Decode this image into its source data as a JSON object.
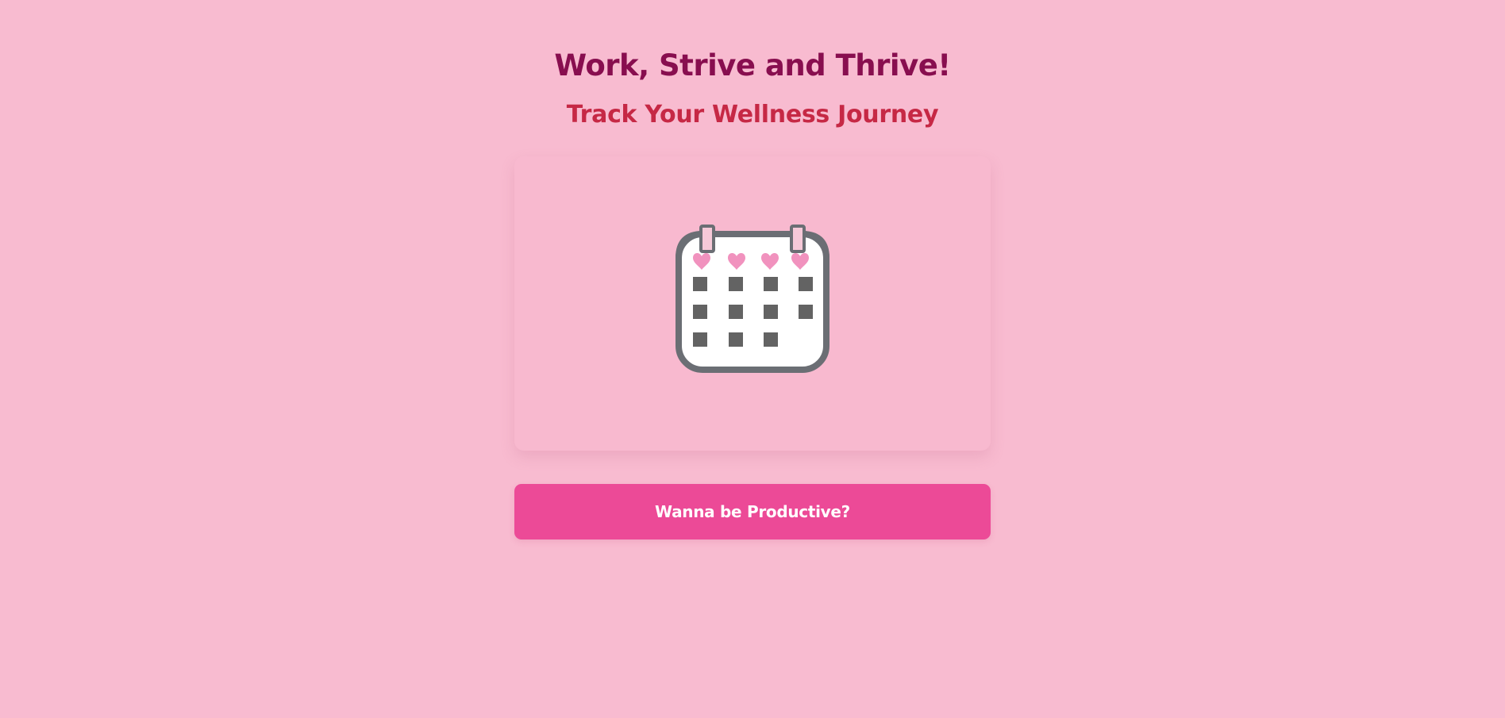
{
  "header": {
    "title": "Work, Strive and Thrive!",
    "subtitle": "Track Your Wellness Journey"
  },
  "card": {
    "icon": "calendar-hearts-icon"
  },
  "cta": {
    "label": "Wanna be Productive?"
  },
  "colors": {
    "background": "#f8bbd0",
    "title": "#880e4f",
    "subtitle": "#c62845",
    "button": "#ec4a97",
    "heart": "#f192be",
    "calendar_frame": "#6b6e74",
    "calendar_cell": "#636363"
  }
}
